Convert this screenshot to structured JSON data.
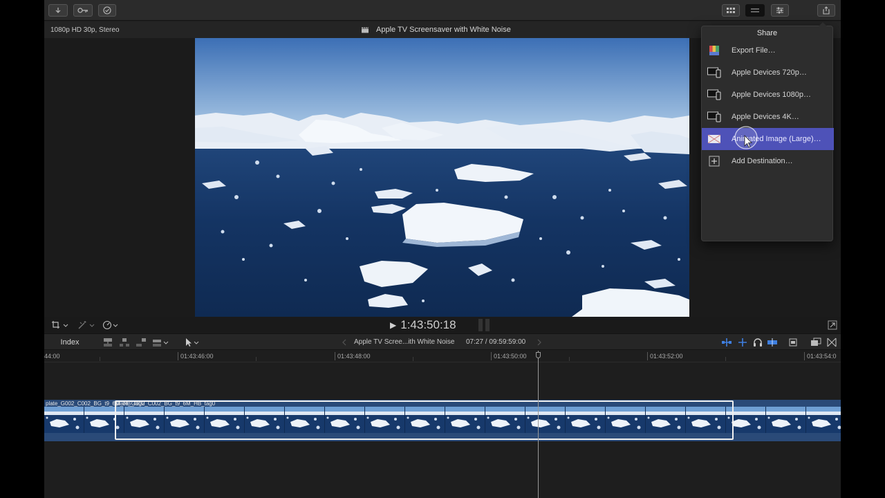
{
  "viewer": {
    "format": "1080p HD 30p, Stereo",
    "title": "Apple TV Screensaver with White Noise"
  },
  "share": {
    "title": "Share",
    "items": [
      {
        "label": "Export File…",
        "icon": "export-file-icon"
      },
      {
        "label": "Apple Devices 720p…",
        "icon": "apple-devices-icon"
      },
      {
        "label": "Apple Devices 1080p…",
        "icon": "apple-devices-icon"
      },
      {
        "label": "Apple Devices 4K…",
        "icon": "apple-devices-icon"
      },
      {
        "label": "Animated Image (Large)…",
        "icon": "animated-image-icon",
        "highlighted": true
      },
      {
        "label": "Add Destination…",
        "icon": "add-icon"
      }
    ],
    "highlight_color": "#4e52b8"
  },
  "transport": {
    "timecode": "1:43:50:18"
  },
  "timeline": {
    "index_label": "Index",
    "project_name": "Apple TV Scree...ith White Noise",
    "duration": "07:27 / 09:59:59:00",
    "ruler_ticks": [
      "44:00",
      "01:43:46:00",
      "01:43:48:00",
      "01:43:50:00",
      "01:43:52:00",
      "01:43:54:0"
    ],
    "clip_label_1": "plate_G002_C002_BG_t9_6M_HB_tag0",
    "clip_label_2": "plate_G002_C002_BG_t9_6M_HB_tag0"
  },
  "colors": {
    "clip_blue": "#2a4a78",
    "tool_blue": "#3f7fe0"
  }
}
